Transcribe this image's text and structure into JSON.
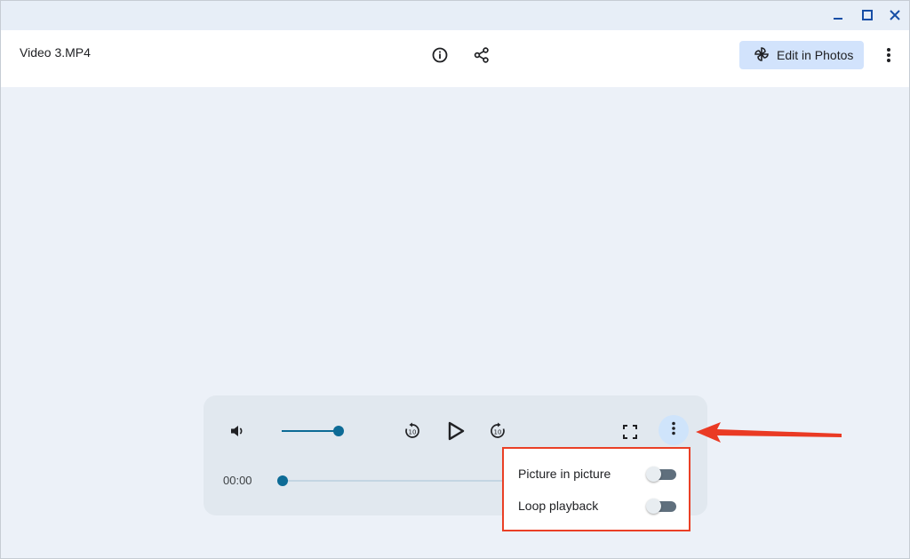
{
  "window": {
    "minimize_icon": "minimize-icon",
    "maximize_icon": "maximize-icon",
    "close_icon": "close-icon"
  },
  "header": {
    "file_name": "Video 3.MP4",
    "info_icon": "info-icon",
    "share_icon": "share-icon",
    "edit_label": "Edit in Photos",
    "edit_icon": "pinwheel-icon",
    "more_icon": "more-vert-icon"
  },
  "player": {
    "volume_icon": "volume-icon",
    "volume_level": 1.0,
    "rewind_icon": "replay-10-icon",
    "play_icon": "play-icon",
    "forward_icon": "forward-10-icon",
    "fullscreen_icon": "fullscreen-icon",
    "more_icon": "more-vert-icon",
    "current_time": "00:00",
    "progress": 0.0
  },
  "menu": {
    "items": [
      {
        "label": "Picture in picture",
        "enabled": false
      },
      {
        "label": "Loop playback",
        "enabled": false
      }
    ]
  },
  "colors": {
    "accent": "#0d6b96",
    "highlight_border": "#ea4026",
    "edit_button_bg": "#d2e3fc",
    "titlebar_icon": "#174ea6"
  }
}
